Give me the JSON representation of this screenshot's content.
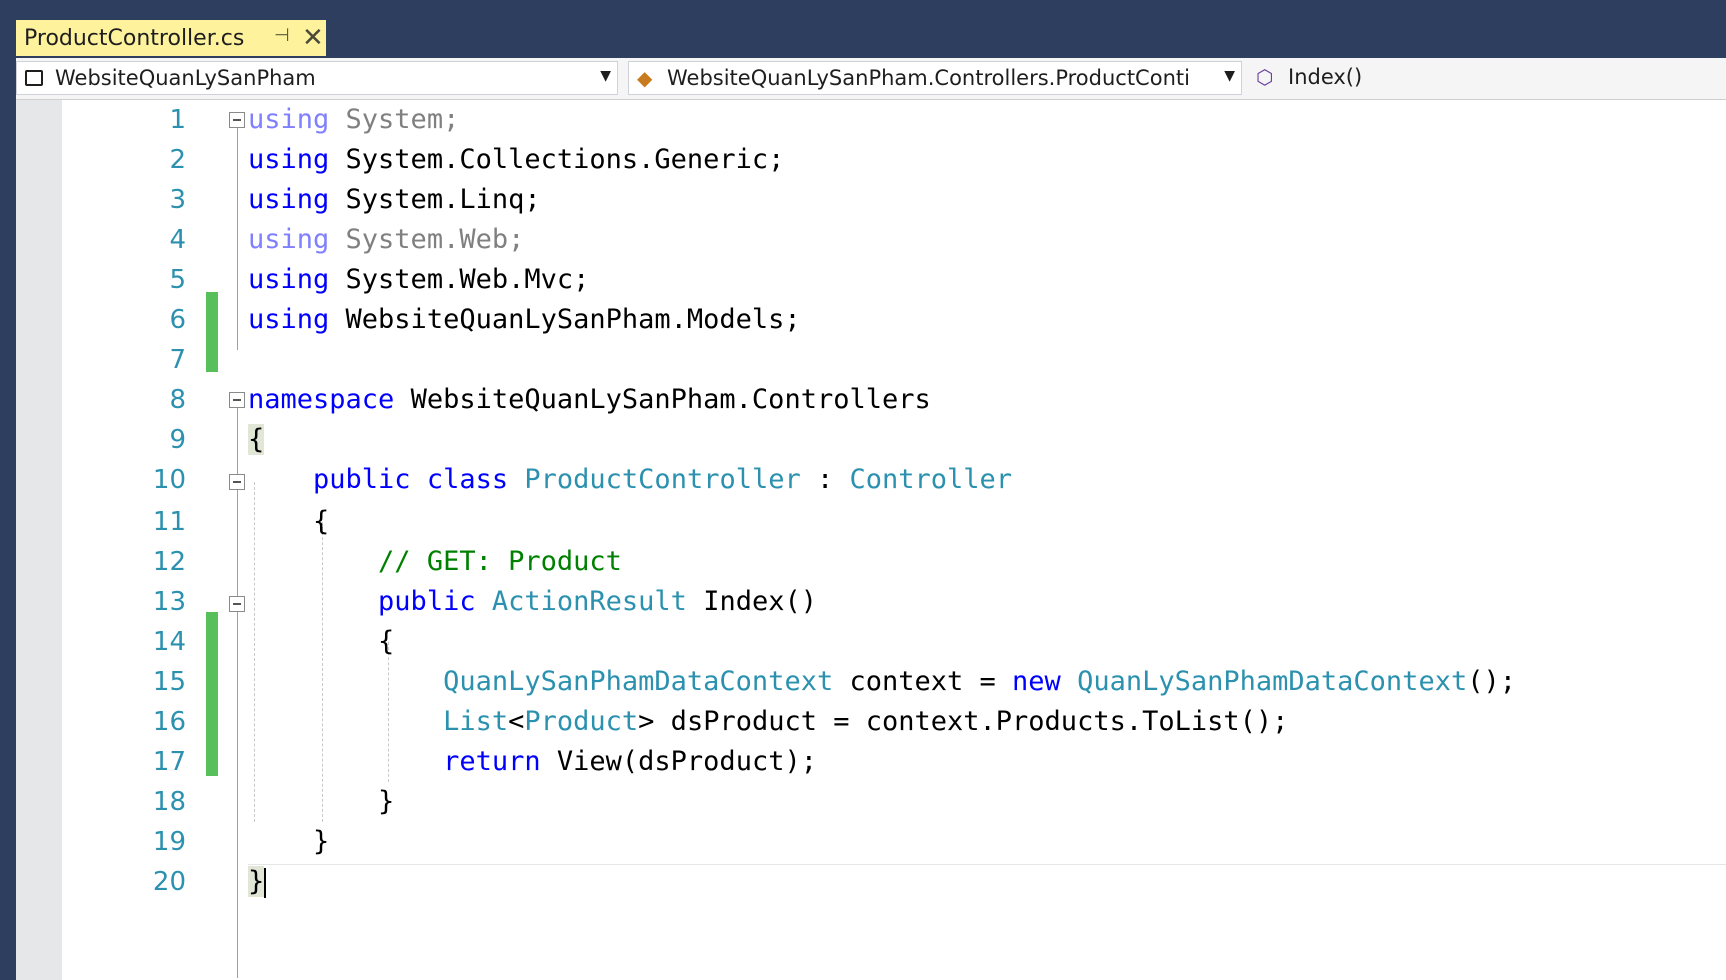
{
  "tab": {
    "title": "ProductController.cs",
    "pin_glyph": "⊣",
    "close_glyph": "✕"
  },
  "nav": {
    "project": "WebsiteQuanLySanPham",
    "class_scope": "WebsiteQuanLySanPham.Controllers.ProductConti",
    "member": "Index()"
  },
  "icons": {
    "project": "csharp-web-project-icon",
    "class": "class-icon",
    "member": "method-icon",
    "dropdown": "chevron-down-icon"
  },
  "colors": {
    "keyword": "#0000ff",
    "type": "#2b91af",
    "comment": "#008000",
    "line_number": "#2b91af",
    "change_bar": "#57c05a",
    "active_tab": "#fff29d",
    "frame": "#2d3e5e"
  },
  "code": {
    "line_numbers": [
      "1",
      "2",
      "3",
      "4",
      "5",
      "6",
      "7",
      "8",
      "9",
      "10",
      "11",
      "12",
      "13",
      "14",
      "15",
      "16",
      "17",
      "18",
      "19",
      "20"
    ],
    "l1_kw": "using",
    "l1_rest": " System;",
    "l2_kw": "using",
    "l2_rest": " System.Collections.Generic;",
    "l3_kw": "using",
    "l3_rest": " System.Linq;",
    "l4_kw": "using",
    "l4_rest": " System.Web;",
    "l5_kw": "using",
    "l5_rest": " System.Web.Mvc;",
    "l6_kw": "using",
    "l6_rest": " WebsiteQuanLySanPham.Models;",
    "l8_kw": "namespace",
    "l8_rest": " WebsiteQuanLySanPham.Controllers",
    "l9": "{",
    "l10_kw1": "public",
    "l10_kw2": "class",
    "l10_type1": "ProductController",
    "l10_sep": " : ",
    "l10_type2": "Controller",
    "l11": "{",
    "l12_comment": "// GET: Product",
    "l13_kw": "public",
    "l13_type": "ActionResult",
    "l13_rest": " Index()",
    "l14": "{",
    "l15_type1": "QuanLySanPhamDataContext",
    "l15_mid": " context = ",
    "l15_kw": "new",
    "l15_type2": "QuanLySanPhamDataContext",
    "l15_end": "();",
    "l16_type1": "List",
    "l16_lt": "<",
    "l16_type2": "Product",
    "l16_rest": "> dsProduct = context.Products.ToList();",
    "l17_kw": "return",
    "l17_rest": " View(dsProduct);",
    "l18": "}",
    "l19": "}",
    "l20": "}"
  }
}
